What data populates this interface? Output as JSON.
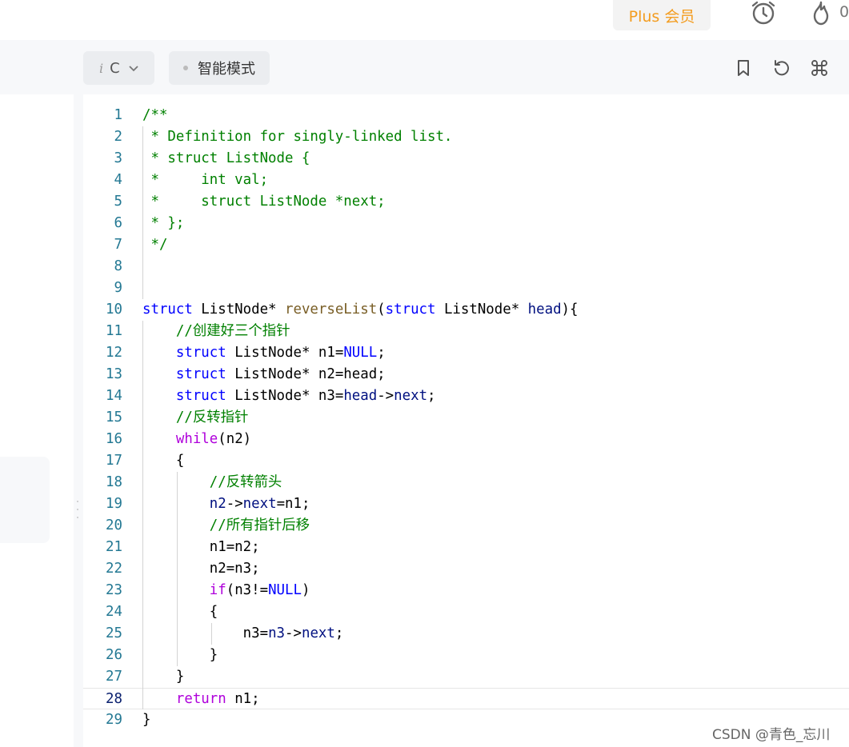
{
  "header": {
    "plus_label": "Plus 会员",
    "counter": "0"
  },
  "toolbar": {
    "lang_prefix": "i",
    "lang_value": "C",
    "mode_label": "智能模式"
  },
  "editor": {
    "active_line": 28,
    "lines": [
      {
        "n": "1",
        "tokens": [
          {
            "t": "/**",
            "c": "c-com"
          }
        ]
      },
      {
        "n": "2",
        "tokens": [
          {
            "t": " * Definition for singly-linked list.",
            "c": "c-com"
          }
        ]
      },
      {
        "n": "3",
        "tokens": [
          {
            "t": " * struct ListNode {",
            "c": "c-com"
          }
        ]
      },
      {
        "n": "4",
        "tokens": [
          {
            "t": " *     int val;",
            "c": "c-com"
          }
        ]
      },
      {
        "n": "5",
        "tokens": [
          {
            "t": " *     struct ListNode *next;",
            "c": "c-com"
          }
        ]
      },
      {
        "n": "6",
        "tokens": [
          {
            "t": " * };",
            "c": "c-com"
          }
        ]
      },
      {
        "n": "7",
        "tokens": [
          {
            "t": " */",
            "c": "c-com"
          }
        ]
      },
      {
        "n": "8",
        "tokens": []
      },
      {
        "n": "9",
        "tokens": []
      },
      {
        "n": "10",
        "tokens": [
          {
            "t": "struct",
            "c": "c-kw"
          },
          {
            "t": " ListNode* ",
            "c": "c-plain"
          },
          {
            "t": "reverseList",
            "c": "c-fn"
          },
          {
            "t": "(",
            "c": "c-plain"
          },
          {
            "t": "struct",
            "c": "c-kw"
          },
          {
            "t": " ListNode* ",
            "c": "c-plain"
          },
          {
            "t": "head",
            "c": "c-var"
          },
          {
            "t": "){",
            "c": "c-plain"
          }
        ]
      },
      {
        "n": "11",
        "tokens": [
          {
            "t": "    ",
            "c": "c-plain"
          },
          {
            "t": "//创建好三个指针",
            "c": "c-com"
          }
        ]
      },
      {
        "n": "12",
        "tokens": [
          {
            "t": "    ",
            "c": "c-plain"
          },
          {
            "t": "struct",
            "c": "c-kw"
          },
          {
            "t": " ListNode* n1=",
            "c": "c-plain"
          },
          {
            "t": "NULL",
            "c": "c-const"
          },
          {
            "t": ";",
            "c": "c-plain"
          }
        ]
      },
      {
        "n": "13",
        "tokens": [
          {
            "t": "    ",
            "c": "c-plain"
          },
          {
            "t": "struct",
            "c": "c-kw"
          },
          {
            "t": " ListNode* n2=head;",
            "c": "c-plain"
          }
        ]
      },
      {
        "n": "14",
        "tokens": [
          {
            "t": "    ",
            "c": "c-plain"
          },
          {
            "t": "struct",
            "c": "c-kw"
          },
          {
            "t": " ListNode* n3=",
            "c": "c-plain"
          },
          {
            "t": "head",
            "c": "c-var"
          },
          {
            "t": "->",
            "c": "c-plain"
          },
          {
            "t": "next",
            "c": "c-var"
          },
          {
            "t": ";",
            "c": "c-plain"
          }
        ]
      },
      {
        "n": "15",
        "tokens": [
          {
            "t": "    ",
            "c": "c-plain"
          },
          {
            "t": "//反转指针",
            "c": "c-com"
          }
        ]
      },
      {
        "n": "16",
        "tokens": [
          {
            "t": "    ",
            "c": "c-plain"
          },
          {
            "t": "while",
            "c": "c-ctrl"
          },
          {
            "t": "(n2)",
            "c": "c-plain"
          }
        ]
      },
      {
        "n": "17",
        "tokens": [
          {
            "t": "    {",
            "c": "c-plain"
          }
        ]
      },
      {
        "n": "18",
        "tokens": [
          {
            "t": "        ",
            "c": "c-plain"
          },
          {
            "t": "//反转箭头",
            "c": "c-com"
          }
        ]
      },
      {
        "n": "19",
        "tokens": [
          {
            "t": "        ",
            "c": "c-plain"
          },
          {
            "t": "n2",
            "c": "c-var"
          },
          {
            "t": "->",
            "c": "c-plain"
          },
          {
            "t": "next",
            "c": "c-var"
          },
          {
            "t": "=n1;",
            "c": "c-plain"
          }
        ]
      },
      {
        "n": "20",
        "tokens": [
          {
            "t": "        ",
            "c": "c-plain"
          },
          {
            "t": "//所有指针后移",
            "c": "c-com"
          }
        ]
      },
      {
        "n": "21",
        "tokens": [
          {
            "t": "        n1=n2;",
            "c": "c-plain"
          }
        ]
      },
      {
        "n": "22",
        "tokens": [
          {
            "t": "        n2=n3;",
            "c": "c-plain"
          }
        ]
      },
      {
        "n": "23",
        "tokens": [
          {
            "t": "        ",
            "c": "c-plain"
          },
          {
            "t": "if",
            "c": "c-ctrl"
          },
          {
            "t": "(n3!=",
            "c": "c-plain"
          },
          {
            "t": "NULL",
            "c": "c-const"
          },
          {
            "t": ")",
            "c": "c-plain"
          }
        ]
      },
      {
        "n": "24",
        "tokens": [
          {
            "t": "        {",
            "c": "c-plain"
          }
        ]
      },
      {
        "n": "25",
        "tokens": [
          {
            "t": "            n3=",
            "c": "c-plain"
          },
          {
            "t": "n3",
            "c": "c-var"
          },
          {
            "t": "->",
            "c": "c-plain"
          },
          {
            "t": "next",
            "c": "c-var"
          },
          {
            "t": ";",
            "c": "c-plain"
          }
        ]
      },
      {
        "n": "26",
        "tokens": [
          {
            "t": "        }",
            "c": "c-plain"
          }
        ]
      },
      {
        "n": "27",
        "tokens": [
          {
            "t": "    }",
            "c": "c-plain"
          }
        ]
      },
      {
        "n": "28",
        "tokens": [
          {
            "t": "    ",
            "c": "c-plain"
          },
          {
            "t": "return",
            "c": "c-ctrl"
          },
          {
            "t": " n1;",
            "c": "c-plain"
          }
        ]
      },
      {
        "n": "29",
        "tokens": [
          {
            "t": "}",
            "c": "c-plain"
          }
        ]
      }
    ]
  },
  "watermark": "CSDN @青色_忘川",
  "icons": {
    "top": [
      "alarm-clock-icon",
      "flame-icon"
    ],
    "toolbar": [
      "bookmark-icon",
      "reset-icon",
      "command-icon"
    ]
  },
  "colors": {
    "accent": "#f39c1f",
    "comment": "#008000",
    "keyword": "#0000ff",
    "control": "#af00db",
    "variable": "#001080",
    "function": "#795e26",
    "line_number": "#237893"
  }
}
